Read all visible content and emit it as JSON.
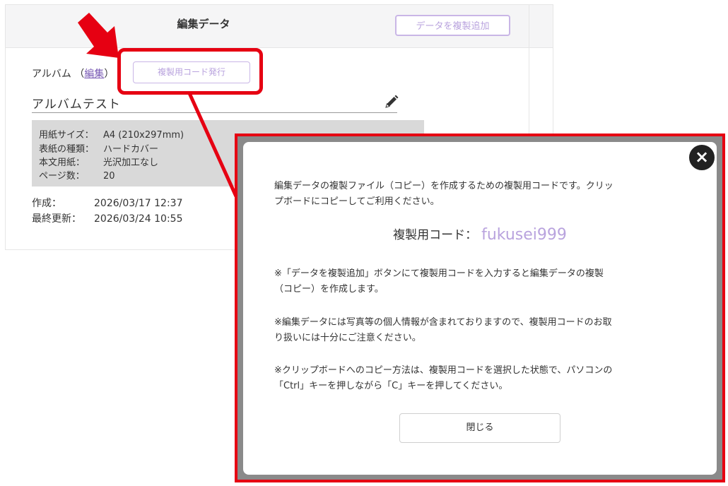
{
  "header": {
    "title": "編集データ",
    "duplicate_add_button": "データを複製追加"
  },
  "album": {
    "label_prefix": "アルバム （",
    "edit_link": "編集",
    "label_suffix": "）",
    "issue_code_button": "複製用コード発行",
    "name": "アルバムテスト",
    "specs": [
      {
        "key": "用紙サイズ：",
        "value": "A4 (210x297mm)"
      },
      {
        "key": "表紙の種類：",
        "value": "ハードカバー"
      },
      {
        "key": "本文用紙：",
        "value": "光沢加工なし"
      },
      {
        "key": "ページ数：",
        "value": "20"
      }
    ],
    "created_label": "作成：",
    "created_value": "2026/03/17 12:37",
    "updated_label": "最終更新：",
    "updated_value": "2026/03/24 10:55"
  },
  "modal": {
    "intro_line1": "編集データの複製ファイル（コピー）を作成するための複製用コードです。クリッ",
    "intro_line2": "プボードにコピーしてご利用ください。",
    "code_label": "複製用コード：",
    "code_value": "fukusei999",
    "note1_line1": "※「データを複製追加」ボタンにて複製用コードを入力すると編集データの複製",
    "note1_line2": "（コピー）を作成します。",
    "note2_line1": "※編集データには写真等の個人情報が含まれておりますので、複製用コードのお取",
    "note2_line2": "り扱いには十分にご注意ください。",
    "note3_line1": "※クリップボードへのコピー方法は、複製用コードを選択した状態で、パソコンの",
    "note3_line2": "「Ctrl」キーを押しながら「C」キーを押してください。",
    "close_button": "閉じる",
    "close_icon": "×"
  },
  "colors": {
    "accent_purple": "#b9a3de",
    "annotation_red": "#e60012"
  }
}
